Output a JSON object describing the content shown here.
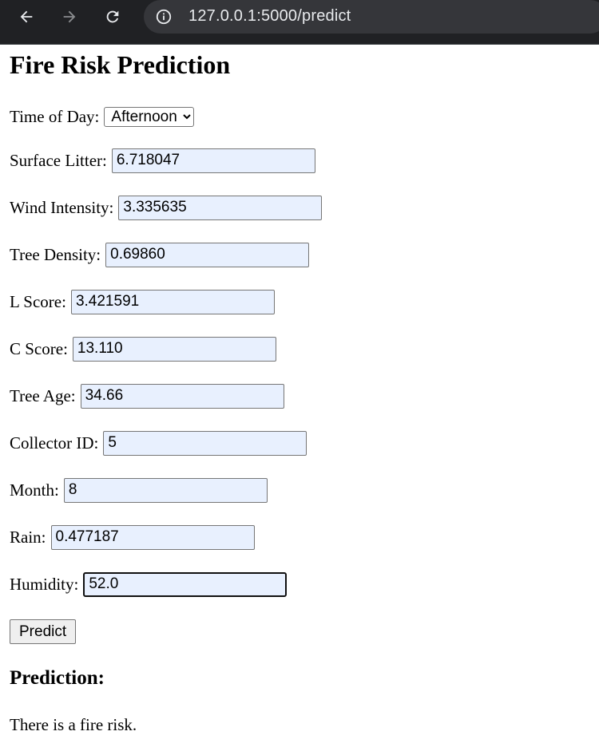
{
  "browser": {
    "url": "127.0.0.1:5000/predict",
    "icons": {
      "back": "back-arrow-icon",
      "forward": "forward-arrow-icon",
      "reload": "reload-icon",
      "info": "info-icon"
    }
  },
  "page": {
    "title": "Fire Risk Prediction",
    "time_of_day": {
      "label": "Time of Day:",
      "value": "Afternoon"
    },
    "fields": [
      {
        "label": "Surface Litter:",
        "value": "6.718047"
      },
      {
        "label": "Wind Intensity:",
        "value": "3.335635"
      },
      {
        "label": "Tree Density:",
        "value": "0.69860"
      },
      {
        "label": "L Score:",
        "value": "3.421591"
      },
      {
        "label": "C Score:",
        "value": "13.110"
      },
      {
        "label": "Tree Age:",
        "value": "34.66"
      },
      {
        "label": "Collector ID:",
        "value": "5"
      },
      {
        "label": "Month:",
        "value": "8"
      },
      {
        "label": "Rain:",
        "value": "0.477187"
      },
      {
        "label": "Humidity:",
        "value": "52.0"
      }
    ],
    "predict_label": "Predict",
    "prediction_heading": "Prediction:",
    "prediction_text": "There is a fire risk."
  }
}
